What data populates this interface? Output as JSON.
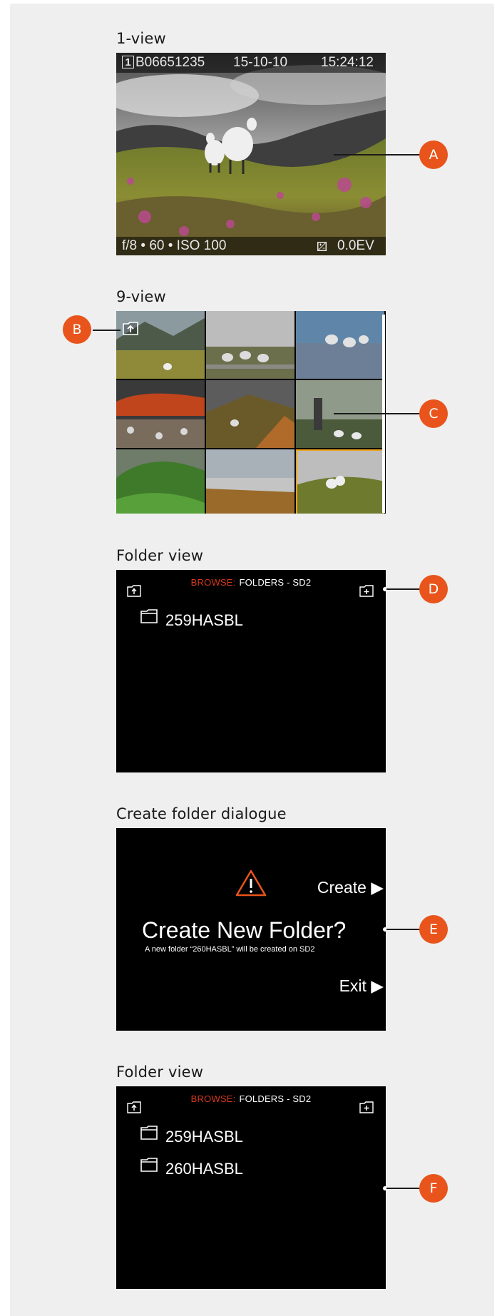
{
  "sections": {
    "one_view": {
      "title": "1-view",
      "view_badge": "1",
      "image_id": "B06651235",
      "date": "15-10-10",
      "time": "15:24:12",
      "exposure": "f/8 • 60 •  ISO 100",
      "ev_icon": "exposure-compensation-icon",
      "ev_value": "0.0EV"
    },
    "nine_view": {
      "title": "9-view",
      "up_icon": "folder-up-icon",
      "selected_index": 8
    },
    "folder_view_1": {
      "title": "Folder view",
      "browse_label": "BROWSE:",
      "browse_path": "FOLDERS - SD2",
      "folders": [
        "259HASBL"
      ]
    },
    "create_dialog": {
      "title": "Create folder dialogue",
      "warning_icon": "warning-triangle-icon",
      "create_label": "Create ▶",
      "heading": "Create New Folder?",
      "message": "A new folder “260HASBL” will be created on SD2",
      "exit_label": "Exit ▶"
    },
    "folder_view_2": {
      "title": "Folder view",
      "browse_label": "BROWSE:",
      "browse_path": "FOLDERS - SD2",
      "folders": [
        "259HASBL",
        "260HASBL"
      ]
    }
  },
  "callouts": {
    "a": "A",
    "b": "B",
    "c": "C",
    "d": "D",
    "e": "E",
    "f": "F"
  },
  "colors": {
    "callout": "#e8541b",
    "browse_key": "#d9381e",
    "selection": "#f0a21a",
    "warning": "#e8541b"
  }
}
